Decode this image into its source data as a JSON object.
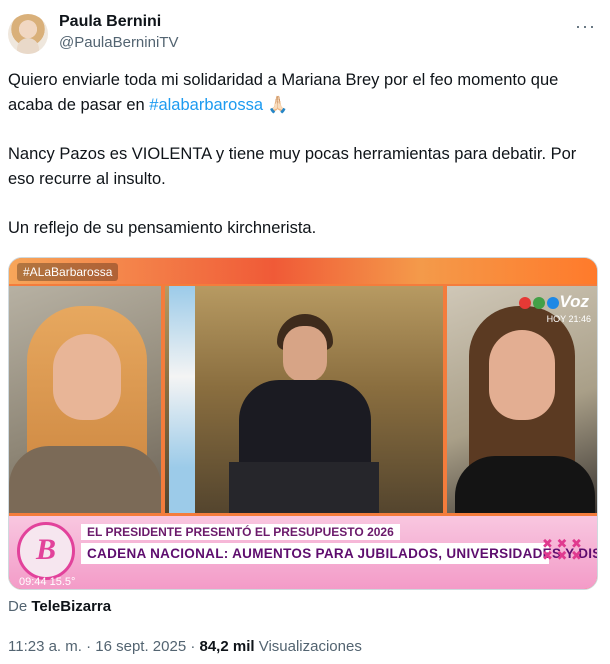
{
  "post": {
    "author_name": "Paula Bernini",
    "author_handle": "@PaulaBerniniTV",
    "more_icon": "···",
    "paragraph1_text": "Quiero enviarle toda mi solidaridad a Mariana Brey por el feo momento que acaba de pasar en ",
    "hashtag": "#alabarbarossa",
    "emoji": "🙏🏻",
    "paragraph2": "Nancy Pazos es VIOLENTA y tiene muy pocas herramientas para debatir. Por eso recurre al insulto.",
    "paragraph3": "Un reflejo de su pensamiento kirchnerista."
  },
  "media": {
    "tag": "#ALaBarbarossa",
    "channel_logo": "Voz",
    "channel_sub": "HOY 21:46",
    "show_logo_letter": "B",
    "subtitle": "EL PRESIDENTE PRESENTÓ EL PRESUPUESTO 2026",
    "headline": "CADENA NACIONAL: AUMENTOS PARA JUBILADOS, UNIVERSIDADES Y DISCAPACIDAD",
    "clock": "09:44   15.5°",
    "colors": {
      "topbar": "#f05a37",
      "lower_third": "#f39ac7",
      "headline_text": "#5e0d6e"
    }
  },
  "source": {
    "prefix": "De ",
    "account": "TeleBizarra"
  },
  "meta": {
    "time": "11:23 a. m. · 16 sept. 2025 · ",
    "views_count": "84,2 mil",
    "views_label": " Visualizaciones"
  }
}
